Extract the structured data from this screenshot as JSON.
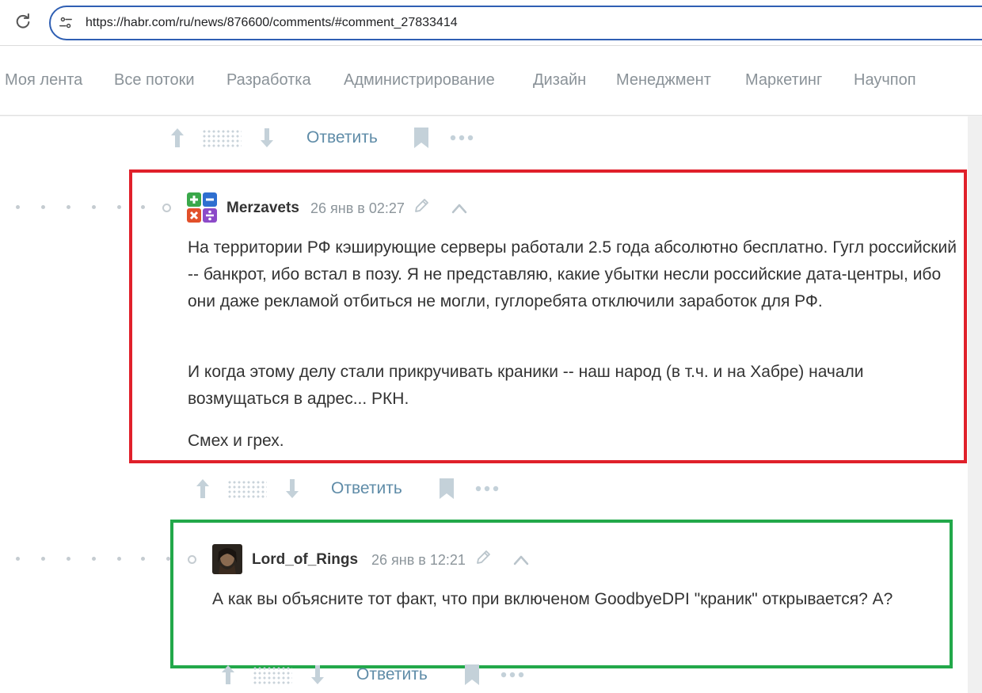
{
  "browser": {
    "url": "https://habr.com/ru/news/876600/comments/#comment_27833414",
    "reload_icon": "reload-icon",
    "site_info_icon": "site-info-icon"
  },
  "nav": {
    "items": [
      "Моя лента",
      "Все потоки",
      "Разработка",
      "Администрирование",
      "Дизайн",
      "Менеджмент",
      "Маркетинг",
      "Научпоп"
    ]
  },
  "actions": {
    "reply_label": "Ответить"
  },
  "comments": [
    {
      "author": "Merzavets",
      "date": "26 янв в 02:27",
      "paragraphs": [
        "На территории РФ кэширующие серверы работали 2.5 года абсолютно бесплатно. Гугл российский -- банкрот, ибо встал в позу. Я не представляю, какие убытки несли российские дата-центры, ибо они даже рекламой отбиться не могли, гуглоребята отключили заработок для РФ.",
        "И когда этому делу стали прикручивать краники -- наш народ (в т.ч. и на Хабре) начали возмущаться в адрес... РКН.",
        "Смех и грех."
      ],
      "highlight_color": "#e0202a"
    },
    {
      "author": "Lord_of_Rings",
      "date": "26 янв в 12:21",
      "paragraphs": [
        "А как вы объясните тот факт, что при включеном GoodbyeDPI \"краник\" открывается? А?"
      ],
      "highlight_color": "#22a84a"
    }
  ]
}
